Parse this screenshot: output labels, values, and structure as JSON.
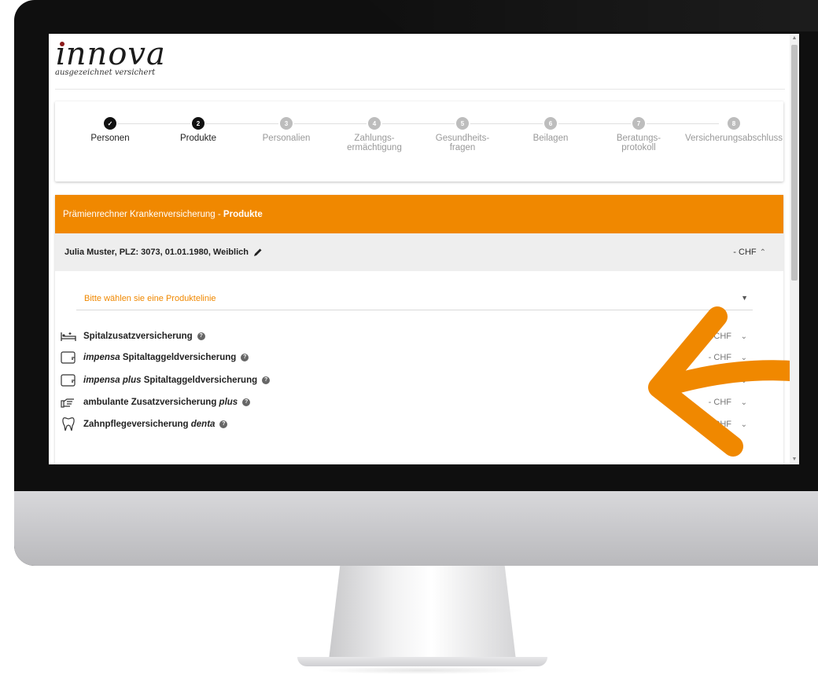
{
  "logo": {
    "wordmark": "ınnova",
    "tagline": "ausgezeichnet versichert"
  },
  "stepper": {
    "steps": [
      {
        "number": "✓",
        "label": "Personen",
        "state": "done"
      },
      {
        "number": "2",
        "label": "Produkte",
        "state": "active"
      },
      {
        "number": "3",
        "label": "Personalien",
        "state": "pending"
      },
      {
        "number": "4",
        "label": "Zahlungs-\nermächtigung",
        "state": "pending"
      },
      {
        "number": "5",
        "label": "Gesundheits-\nfragen",
        "state": "pending"
      },
      {
        "number": "6",
        "label": "Beilagen",
        "state": "pending"
      },
      {
        "number": "7",
        "label": "Beratungs-\nprotokoll",
        "state": "pending"
      },
      {
        "number": "8",
        "label": "Versicherungsabschluss",
        "state": "pending"
      }
    ]
  },
  "panel": {
    "title_prefix": "Prämienrechner Krankenversicherung - ",
    "title_bold": "Produkte",
    "person_summary": "Julia Muster, PLZ: 3073, 01.01.1980, Weiblich",
    "person_chf": "- CHF",
    "product_line_placeholder": "Bitte wählen sie eine Produktelinie",
    "products": [
      {
        "icon": "bed-icon",
        "name_parts": [
          {
            "t": "Spitalzusatzversicherung",
            "i": false
          }
        ],
        "chf": "- CHF"
      },
      {
        "icon": "wallet-icon",
        "name_parts": [
          {
            "t": "impensa",
            "i": true
          },
          {
            "t": " Spitaltaggeldversicherung",
            "i": false
          }
        ],
        "chf": "- CHF"
      },
      {
        "icon": "wallet-icon",
        "name_parts": [
          {
            "t": "impensa plus",
            "i": true
          },
          {
            "t": " Spitaltaggeldversicherung",
            "i": false
          }
        ],
        "chf": "- CHF"
      },
      {
        "icon": "hand-icon",
        "name_parts": [
          {
            "t": "ambulante Zusatzversicherung ",
            "i": false
          },
          {
            "t": "plus",
            "i": true
          }
        ],
        "chf": "- CHF"
      },
      {
        "icon": "tooth-icon",
        "name_parts": [
          {
            "t": "Zahnpflegeversicherung ",
            "i": false
          },
          {
            "t": "denta",
            "i": true
          }
        ],
        "chf": "- CHF"
      }
    ]
  },
  "colors": {
    "accent": "#f08800",
    "dark": "#111111",
    "logo_dot": "#8b1a1a"
  }
}
